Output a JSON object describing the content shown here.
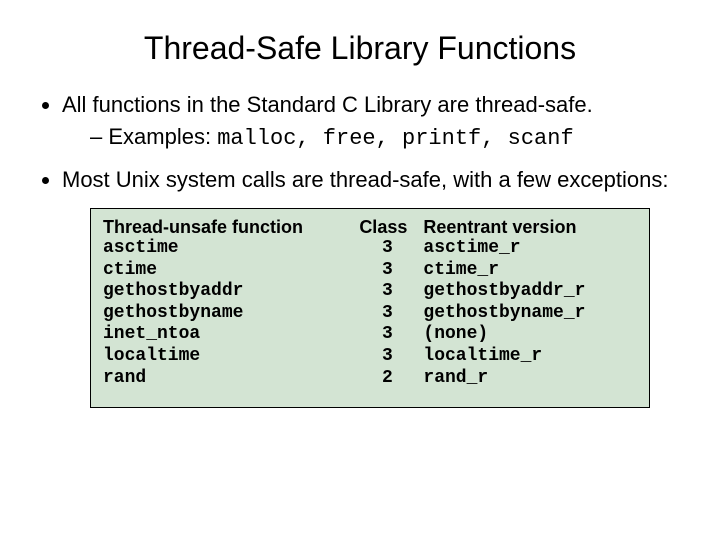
{
  "title": "Thread-Safe Library Functions",
  "bullets": {
    "b1": "All functions in the Standard C Library are thread-safe.",
    "b1_sub_label": "Examples: ",
    "b1_sub_code": "malloc, free, printf, scanf",
    "b2": "Most Unix system calls are thread-safe, with a few exceptions:"
  },
  "table": {
    "headers": {
      "func": "Thread-unsafe function",
      "cls": "Class",
      "re": "Reentrant version"
    },
    "rows": [
      {
        "func": "asctime",
        "cls": "3",
        "re": "asctime_r"
      },
      {
        "func": "ctime",
        "cls": "3",
        "re": "ctime_r"
      },
      {
        "func": "gethostbyaddr",
        "cls": "3",
        "re": "gethostbyaddr_r"
      },
      {
        "func": "gethostbyname",
        "cls": "3",
        "re": "gethostbyname_r"
      },
      {
        "func": "inet_ntoa",
        "cls": "3",
        "re": " (none)"
      },
      {
        "func": "localtime",
        "cls": "3",
        "re": "localtime_r"
      },
      {
        "func": "rand",
        "cls": "2",
        "re": "rand_r"
      }
    ]
  }
}
